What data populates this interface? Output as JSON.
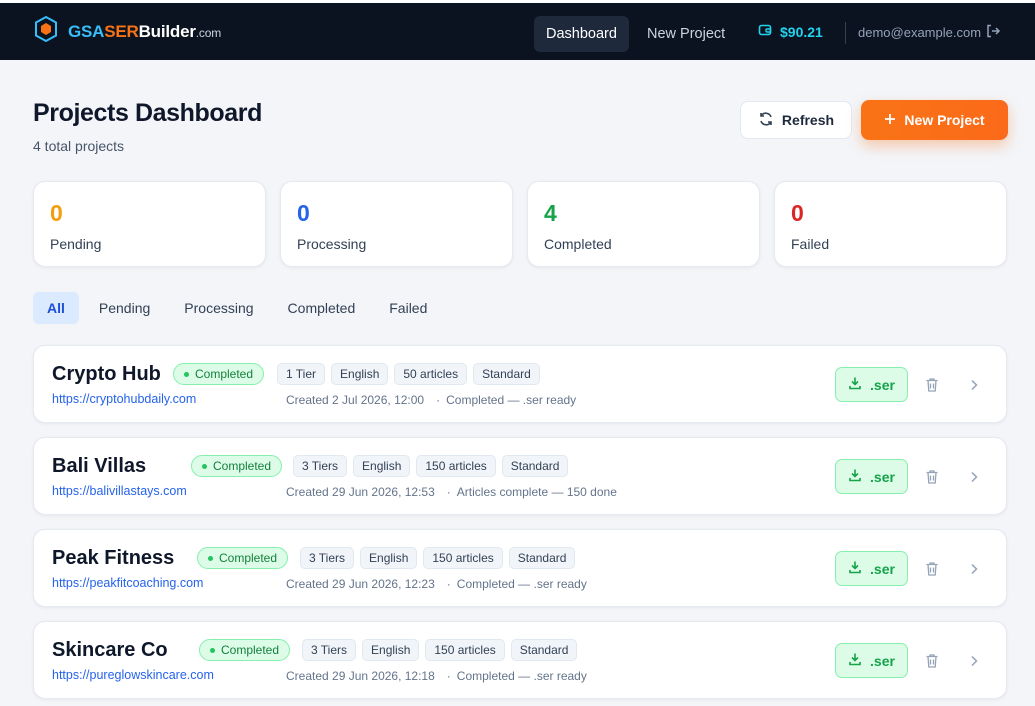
{
  "header": {
    "brand": {
      "gsa": "GSA",
      "ser": "SER",
      "builder": "Builder",
      "tld": ".com"
    },
    "nav": {
      "dashboard": "Dashboard",
      "new_project": "New Project"
    },
    "balance": "$90.21",
    "user_email": "demo@example.com"
  },
  "page": {
    "title": "Projects Dashboard",
    "subtitle": "4 total projects",
    "refresh_label": "Refresh",
    "new_project_label": "New Project"
  },
  "stats": [
    {
      "value": "0",
      "label": "Pending",
      "color": "#f59e0b"
    },
    {
      "value": "0",
      "label": "Processing",
      "color": "#2563eb"
    },
    {
      "value": "4",
      "label": "Completed",
      "color": "#16a34a"
    },
    {
      "value": "0",
      "label": "Failed",
      "color": "#dc2626"
    }
  ],
  "filters": [
    "All",
    "Pending",
    "Processing",
    "Completed",
    "Failed"
  ],
  "projects": [
    {
      "name": "Crypto Hub",
      "status": "Completed",
      "tags": [
        "1 Tier",
        "English",
        "50 articles",
        "Standard"
      ],
      "url": "https://cryptohubdaily.com",
      "created": "Created 2 Jul 2026, 12:00",
      "state": "Completed — .ser ready",
      "download_label": ".ser"
    },
    {
      "name": "Bali Villas",
      "status": "Completed",
      "tags": [
        "3 Tiers",
        "English",
        "150 articles",
        "Standard"
      ],
      "url": "https://balivillastays.com",
      "created": "Created 29 Jun 2026, 12:53",
      "state": "Articles complete — 150 done",
      "download_label": ".ser"
    },
    {
      "name": "Peak Fitness",
      "status": "Completed",
      "tags": [
        "3 Tiers",
        "English",
        "150 articles",
        "Standard"
      ],
      "url": "https://peakfitcoaching.com",
      "created": "Created 29 Jun 2026, 12:23",
      "state": "Completed — .ser ready",
      "download_label": ".ser"
    },
    {
      "name": "Skincare Co",
      "status": "Completed",
      "tags": [
        "3 Tiers",
        "English",
        "150 articles",
        "Standard"
      ],
      "url": "https://pureglowskincare.com",
      "created": "Created 29 Jun 2026, 12:18",
      "state": "Completed — .ser ready",
      "download_label": ".ser"
    }
  ]
}
